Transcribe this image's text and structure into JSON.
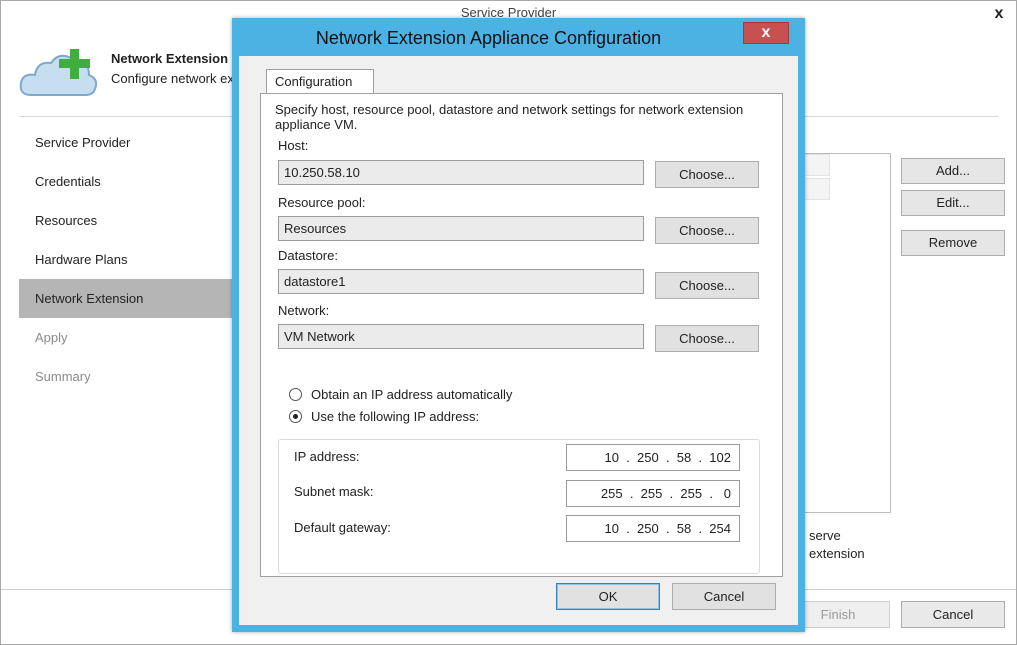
{
  "wizard": {
    "title": "Service Provider",
    "close_glyph": "x",
    "header": {
      "title": "Network Extension",
      "subtitle": "Configure network extension"
    },
    "steps": [
      {
        "label": "Service Provider",
        "state": "normal"
      },
      {
        "label": "Credentials",
        "state": "normal"
      },
      {
        "label": "Resources",
        "state": "normal"
      },
      {
        "label": "Hardware Plans",
        "state": "normal"
      },
      {
        "label": "Network Extension",
        "state": "active"
      },
      {
        "label": "Apply",
        "state": "disabled"
      },
      {
        "label": "Summary",
        "state": "disabled"
      }
    ],
    "side_buttons": {
      "add": "Add...",
      "edit": "Edit...",
      "remove": "Remove"
    },
    "note_lines": [
      "serve",
      "extension"
    ],
    "footer": {
      "finish": "Finish",
      "cancel": "Cancel"
    }
  },
  "dialog": {
    "title": "Network Extension Appliance Configuration",
    "close_glyph": "x",
    "tab": "Configuration",
    "description": "Specify host, resource pool, datastore and network settings for network extension appliance VM.",
    "host": {
      "label": "Host:",
      "value": "10.250.58.10"
    },
    "resource_pool": {
      "label": "Resource pool:",
      "value": "Resources"
    },
    "datastore": {
      "label": "Datastore:",
      "value": "datastore1"
    },
    "network": {
      "label": "Network:",
      "value": "VM Network"
    },
    "choose_label": "Choose...",
    "radio_auto": {
      "label": "Obtain an IP address automatically",
      "checked": false
    },
    "radio_manual": {
      "label": "Use the following IP address:",
      "checked": true
    },
    "ip": {
      "ip_label": "IP address:",
      "ip_value": "10  .  250  .  58  .  102",
      "mask_label": "Subnet mask:",
      "mask_value": "255  .  255  .  255  .   0",
      "gateway_label": "Default gateway:",
      "gateway_value": "10  .  250  .  58  .  254"
    },
    "ok": "OK",
    "cancel": "Cancel"
  },
  "colors": {
    "dialog_border": "#4cb2e4",
    "close_button": "#c75050",
    "active_step": "#b5b5b5",
    "cloud": "#c6def0",
    "plus": "#3fae3f"
  }
}
